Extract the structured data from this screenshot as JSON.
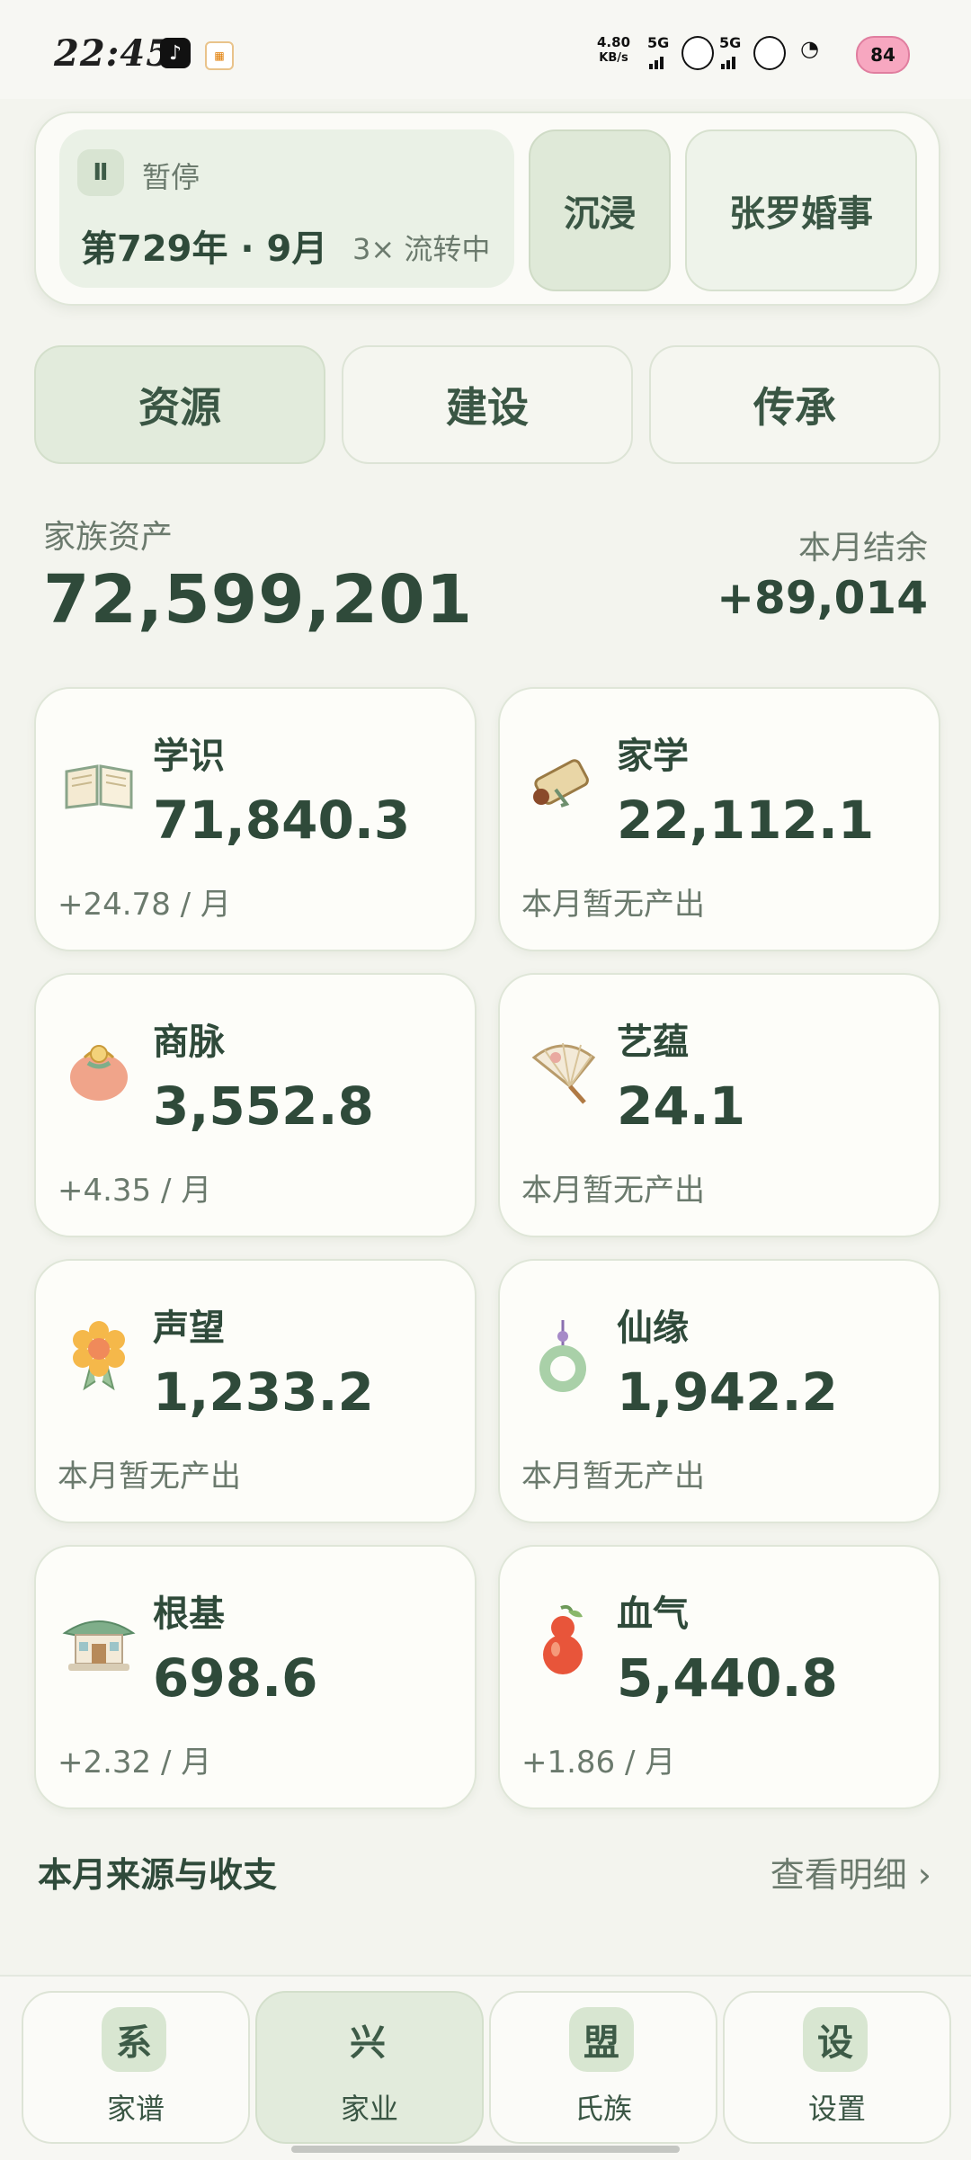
{
  "status_bar": {
    "time": "22:45",
    "net_speed_value": "4.80",
    "net_speed_unit": "KB/s",
    "signal_1": "5G",
    "signal_2": "5G",
    "battery": "84"
  },
  "top_card": {
    "pause_label": "暂停",
    "date": "第729年 · 9月",
    "speed": "3× 流转中",
    "mode_button": "沉浸",
    "event_button": "张罗婚事"
  },
  "tabs": [
    {
      "label": "资源",
      "active": true
    },
    {
      "label": "建设",
      "active": false
    },
    {
      "label": "传承",
      "active": false
    }
  ],
  "assets": {
    "label": "家族资产",
    "value": "72,599,201",
    "balance_label": "本月结余",
    "balance_value": "+89,014"
  },
  "resources": [
    {
      "name": "学识",
      "value": "71,840.3",
      "rate": "+24.78 / 月",
      "icon": "book-icon"
    },
    {
      "name": "家学",
      "value": "22,112.1",
      "rate": "本月暂无产出",
      "icon": "scroll-icon"
    },
    {
      "name": "商脉",
      "value": "3,552.8",
      "rate": "+4.35 / 月",
      "icon": "money-bag-icon"
    },
    {
      "name": "艺蕴",
      "value": "24.1",
      "rate": "本月暂无产出",
      "icon": "folding-fan-icon"
    },
    {
      "name": "声望",
      "value": "1,233.2",
      "rate": "本月暂无产出",
      "icon": "flower-badge-icon"
    },
    {
      "name": "仙缘",
      "value": "1,942.2",
      "rate": "本月暂无产出",
      "icon": "jade-pendant-icon"
    },
    {
      "name": "根基",
      "value": "698.6",
      "rate": "+2.32 / 月",
      "icon": "house-icon"
    },
    {
      "name": "血气",
      "value": "5,440.8",
      "rate": "+1.86 / 月",
      "icon": "gourd-icon"
    }
  ],
  "section": {
    "title": "本月来源与收支",
    "link": "查看明细 ›"
  },
  "nav": [
    {
      "glyph": "系",
      "label": "家谱",
      "active": false
    },
    {
      "glyph": "兴",
      "label": "家业",
      "active": true
    },
    {
      "glyph": "盟",
      "label": "氏族",
      "active": false
    },
    {
      "glyph": "设",
      "label": "设置",
      "active": false
    }
  ]
}
